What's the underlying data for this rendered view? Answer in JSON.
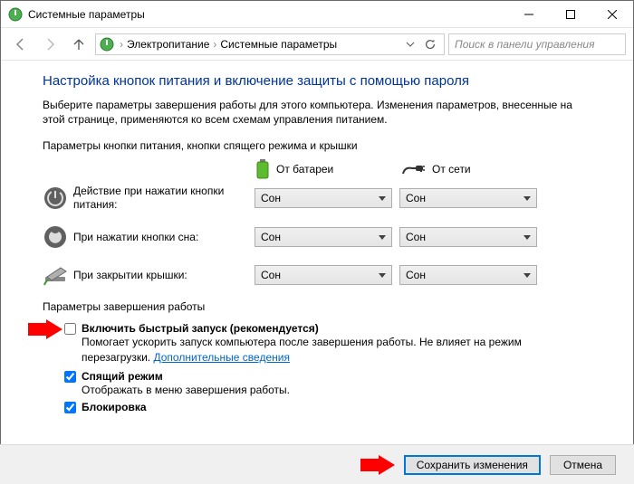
{
  "window": {
    "title": "Системные параметры"
  },
  "nav": {
    "breadcrumb": {
      "item1": "Электропитание",
      "item2": "Системные параметры"
    },
    "search_placeholder": "Поиск в панели управления"
  },
  "page": {
    "heading": "Настройка кнопок питания и включение защиты с помощью пароля",
    "intro": "Выберите параметры завершения работы для этого компьютера. Изменения параметров, внесенные на этой странице, применяются ко всем схемам управления питанием.",
    "buttons_section_label": "Параметры кнопки питания, кнопки спящего режима и крышки",
    "col_battery": "От батареи",
    "col_plugged": "От сети",
    "rows": [
      {
        "label": "Действие при нажатии кнопки питания:",
        "battery": "Сон",
        "plugged": "Сон"
      },
      {
        "label": "При нажатии кнопки сна:",
        "battery": "Сон",
        "plugged": "Сон"
      },
      {
        "label": "При закрытии крышки:",
        "battery": "Сон",
        "plugged": "Сон"
      }
    ],
    "shutdown_section_label": "Параметры завершения работы",
    "fast_startup": {
      "checked": false,
      "title": "Включить быстрый запуск (рекомендуется)",
      "desc_part1": "Помогает ускорить запуск компьютера после завершения работы. Не влияет на режим перезагрузки. ",
      "link": "Дополнительные сведения"
    },
    "sleep": {
      "checked": true,
      "title": "Спящий режим",
      "desc": "Отображать в меню завершения работы."
    },
    "lock": {
      "checked": true,
      "title": "Блокировка"
    }
  },
  "footer": {
    "save": "Сохранить изменения",
    "cancel": "Отмена"
  }
}
